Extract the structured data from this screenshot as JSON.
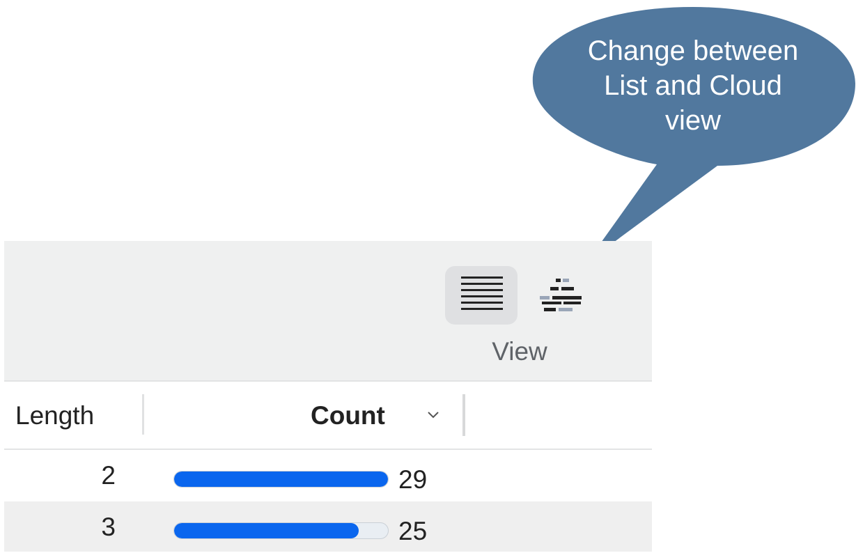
{
  "callout": {
    "lines": [
      "Change between",
      "List and Cloud",
      "view"
    ],
    "color": "#51789e"
  },
  "toolbar": {
    "view_label": "View",
    "list_button": {
      "icon": "list-view-icon",
      "selected": true
    },
    "cloud_button": {
      "icon": "word-cloud-icon",
      "selected": false
    }
  },
  "table": {
    "columns": [
      "Length",
      "Count"
    ],
    "sort_icon": "chevron-down-icon",
    "accent": "#0a66ee",
    "rows": [
      {
        "length": "2",
        "count": "29",
        "fraction": 1.0
      },
      {
        "length": "3",
        "count": "25",
        "fraction": 0.862
      }
    ]
  }
}
